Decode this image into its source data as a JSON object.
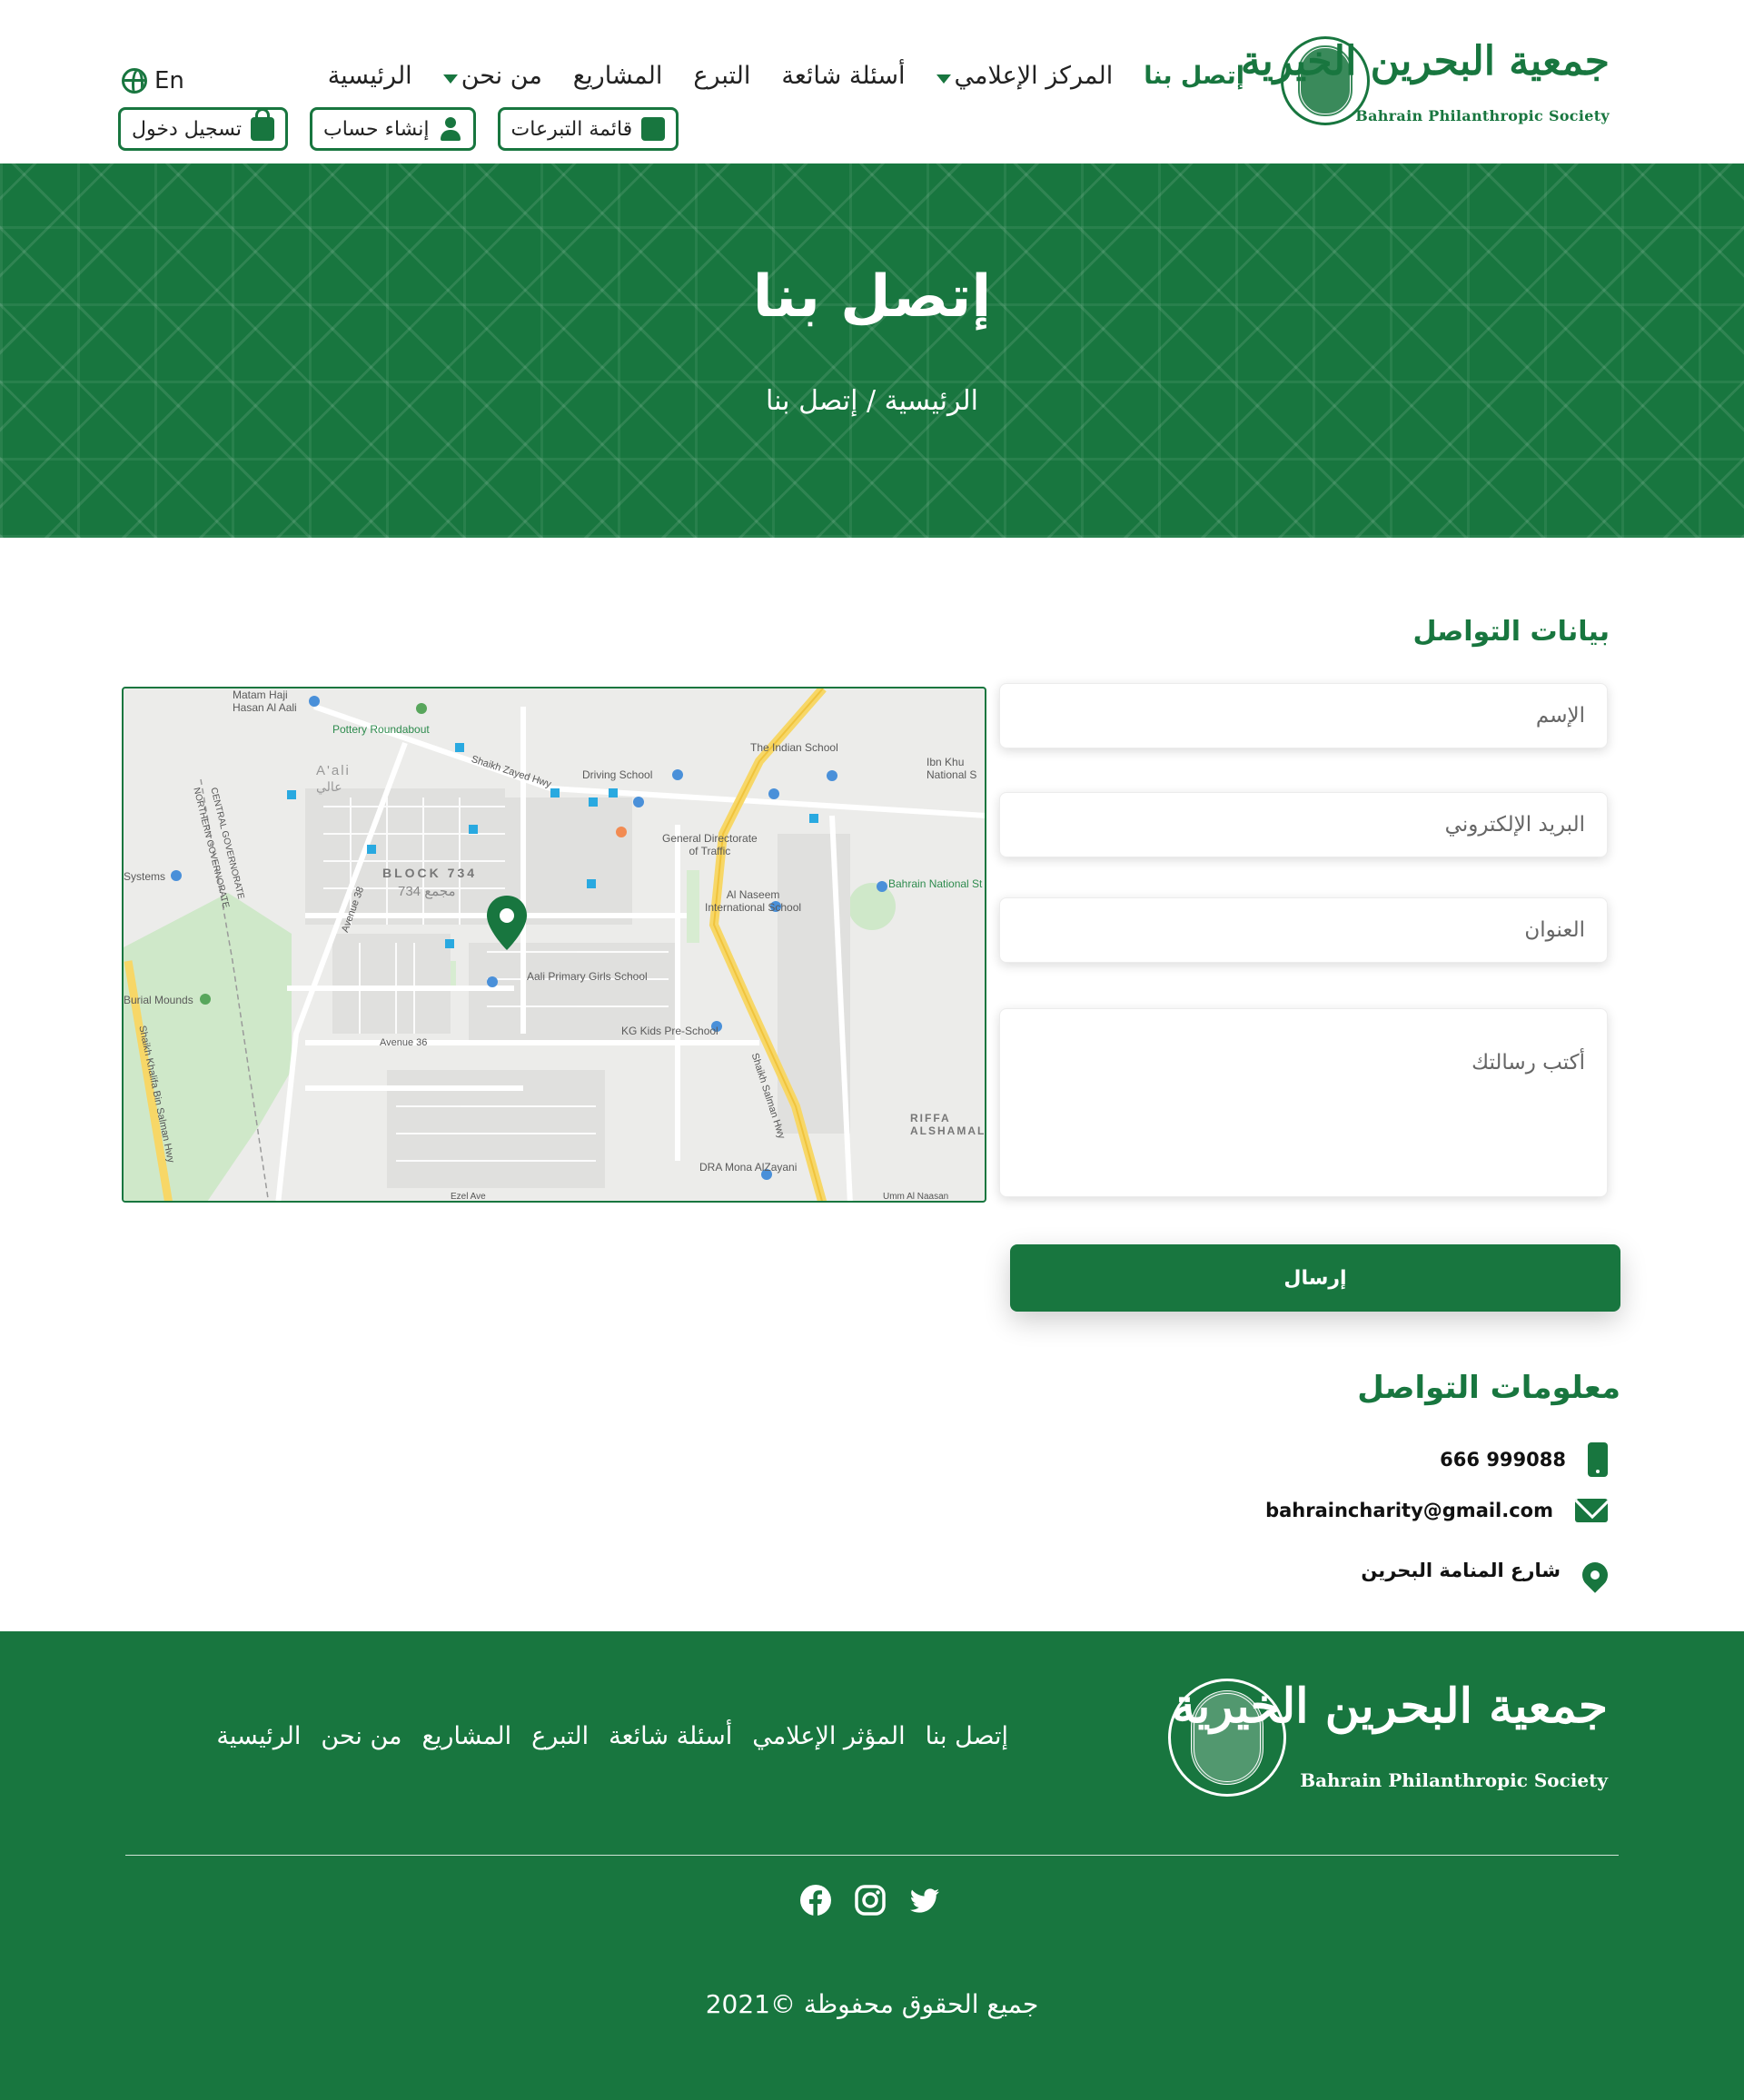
{
  "brand": {
    "name_ar": "جمعية البحرين الخيرية",
    "name_en": "Bahrain Philanthropic Society",
    "color": "#18763f"
  },
  "nav": {
    "items": [
      {
        "label": "الرئيسية",
        "dropdown": false,
        "active": false
      },
      {
        "label": "من نحن",
        "dropdown": true,
        "active": false
      },
      {
        "label": "المشاريع",
        "dropdown": false,
        "active": false
      },
      {
        "label": "التبرع",
        "dropdown": false,
        "active": false
      },
      {
        "label": "أسئلة شائعة",
        "dropdown": false,
        "active": false
      },
      {
        "label": "المركز الإعلامي",
        "dropdown": true,
        "active": false
      },
      {
        "label": "إتصل بنا",
        "dropdown": false,
        "active": true
      }
    ],
    "language": "En",
    "language_icon": "globe-icon"
  },
  "header_buttons": {
    "donations_list": "قائمة التبرعات",
    "register": "إنشاء حساب",
    "login": "تسجيل دخول"
  },
  "hero": {
    "title": "إتصل بنا",
    "breadcrumb": "الرئيسية / إتصل بنا"
  },
  "form": {
    "title": "بيانات التواصل",
    "name_placeholder": "الإسم",
    "email_placeholder": "البريد الإلكتروني",
    "address_placeholder": "العنوان",
    "message_placeholder": "أكتب رسالتك",
    "submit_label": "إرسال"
  },
  "map": {
    "labels": {
      "matam": "Matam Haji\nHasan Al Aali",
      "pottery": "Pottery Roundabout",
      "aali": "A'ali",
      "aali_ar": "عالي",
      "block": "BLOCK 734",
      "block_ar": "مجمع 734",
      "indian_school": "The Indian School",
      "ibn_khuldoon": "Ibn Khu\nNational S",
      "driving_school": "Driving School",
      "gdt": "General Directorate\nof Traffic",
      "naseem": "Al Naseem\nInternational School",
      "bahrain_national": "Bahrain National St",
      "aali_primary": "Aali Primary Girls School",
      "kg_kids": "KG Kids Pre-School",
      "burial": "Burial Mounds",
      "riffa": "RIFFA\nALSHAMAL",
      "dra": "DRA Mona AlZayani",
      "shaikh_salman": "Shaikh Salman Hwy",
      "shaikh_khalifa": "Shaikh Khalifa Bin Salman Hwy",
      "shaikh_zayed": "Shaikh Zayed Hwy",
      "avenue_36": "Avenue 36",
      "avenue_38": "Avenue 38",
      "northern": "NORTHERN GOVERNORATE",
      "central": "CENTRAL GOVERNORATE",
      "systems": "Systems",
      "ezel": "Ezel Ave",
      "umm": "Umm Al Naasan"
    },
    "marker_icon": "map-pin-icon"
  },
  "contact_info": {
    "title": "معلومات التواصل",
    "phone": "666 999088",
    "email": "bahraincharity@gmail.com",
    "address": "شارع المنامة البحرين"
  },
  "footer": {
    "nav": [
      "الرئيسية",
      "من نحن",
      "المشاريع",
      "التبرع",
      "أسئلة شائعة",
      "المؤثر الإعلامي",
      "إتصل بنا"
    ],
    "social": [
      "twitter-icon",
      "instagram-icon",
      "facebook-icon"
    ],
    "copyright": "جميع الحقوق محفوظة ©2021"
  }
}
